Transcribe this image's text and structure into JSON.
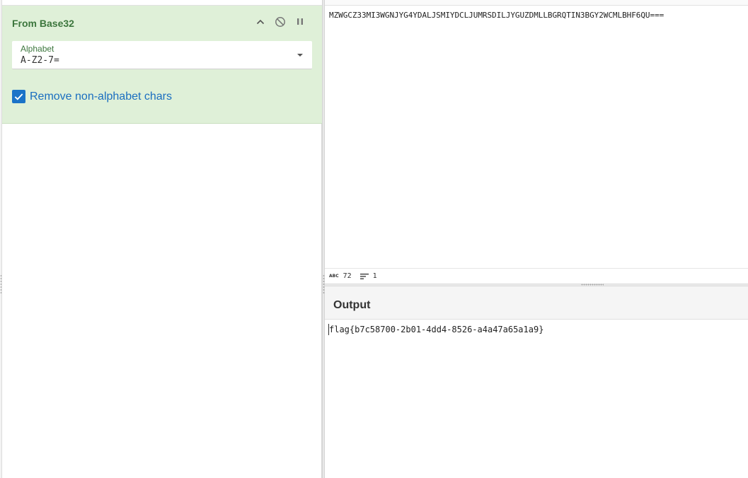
{
  "recipe": {
    "operation": {
      "title": "From Base32",
      "controls": {
        "collapse_icon": "chevron-up-icon",
        "disable_icon": "disable-icon",
        "pause_icon": "pause-icon"
      },
      "alphabet": {
        "label": "Alphabet",
        "value": "A-Z2-7="
      },
      "remove_non_alphabet": {
        "label": "Remove non-alphabet chars",
        "checked": true
      }
    }
  },
  "input": {
    "text": "MZWGCZ33MI3WGNJYG4YDALJSMIYDCLJUMRSDILJYGUZDMLLBGRQTIN3BGY2WCMLBHF6QU===",
    "status": {
      "length": "72",
      "lines": "1"
    }
  },
  "output": {
    "title": "Output",
    "text": "flag{b7c58700-2b01-4dd4-8526-a4a47a65a1a9}"
  },
  "colors": {
    "op_bg": "#dff0d8",
    "op_title": "#3c763d",
    "checkbox": "#1a73c8"
  }
}
